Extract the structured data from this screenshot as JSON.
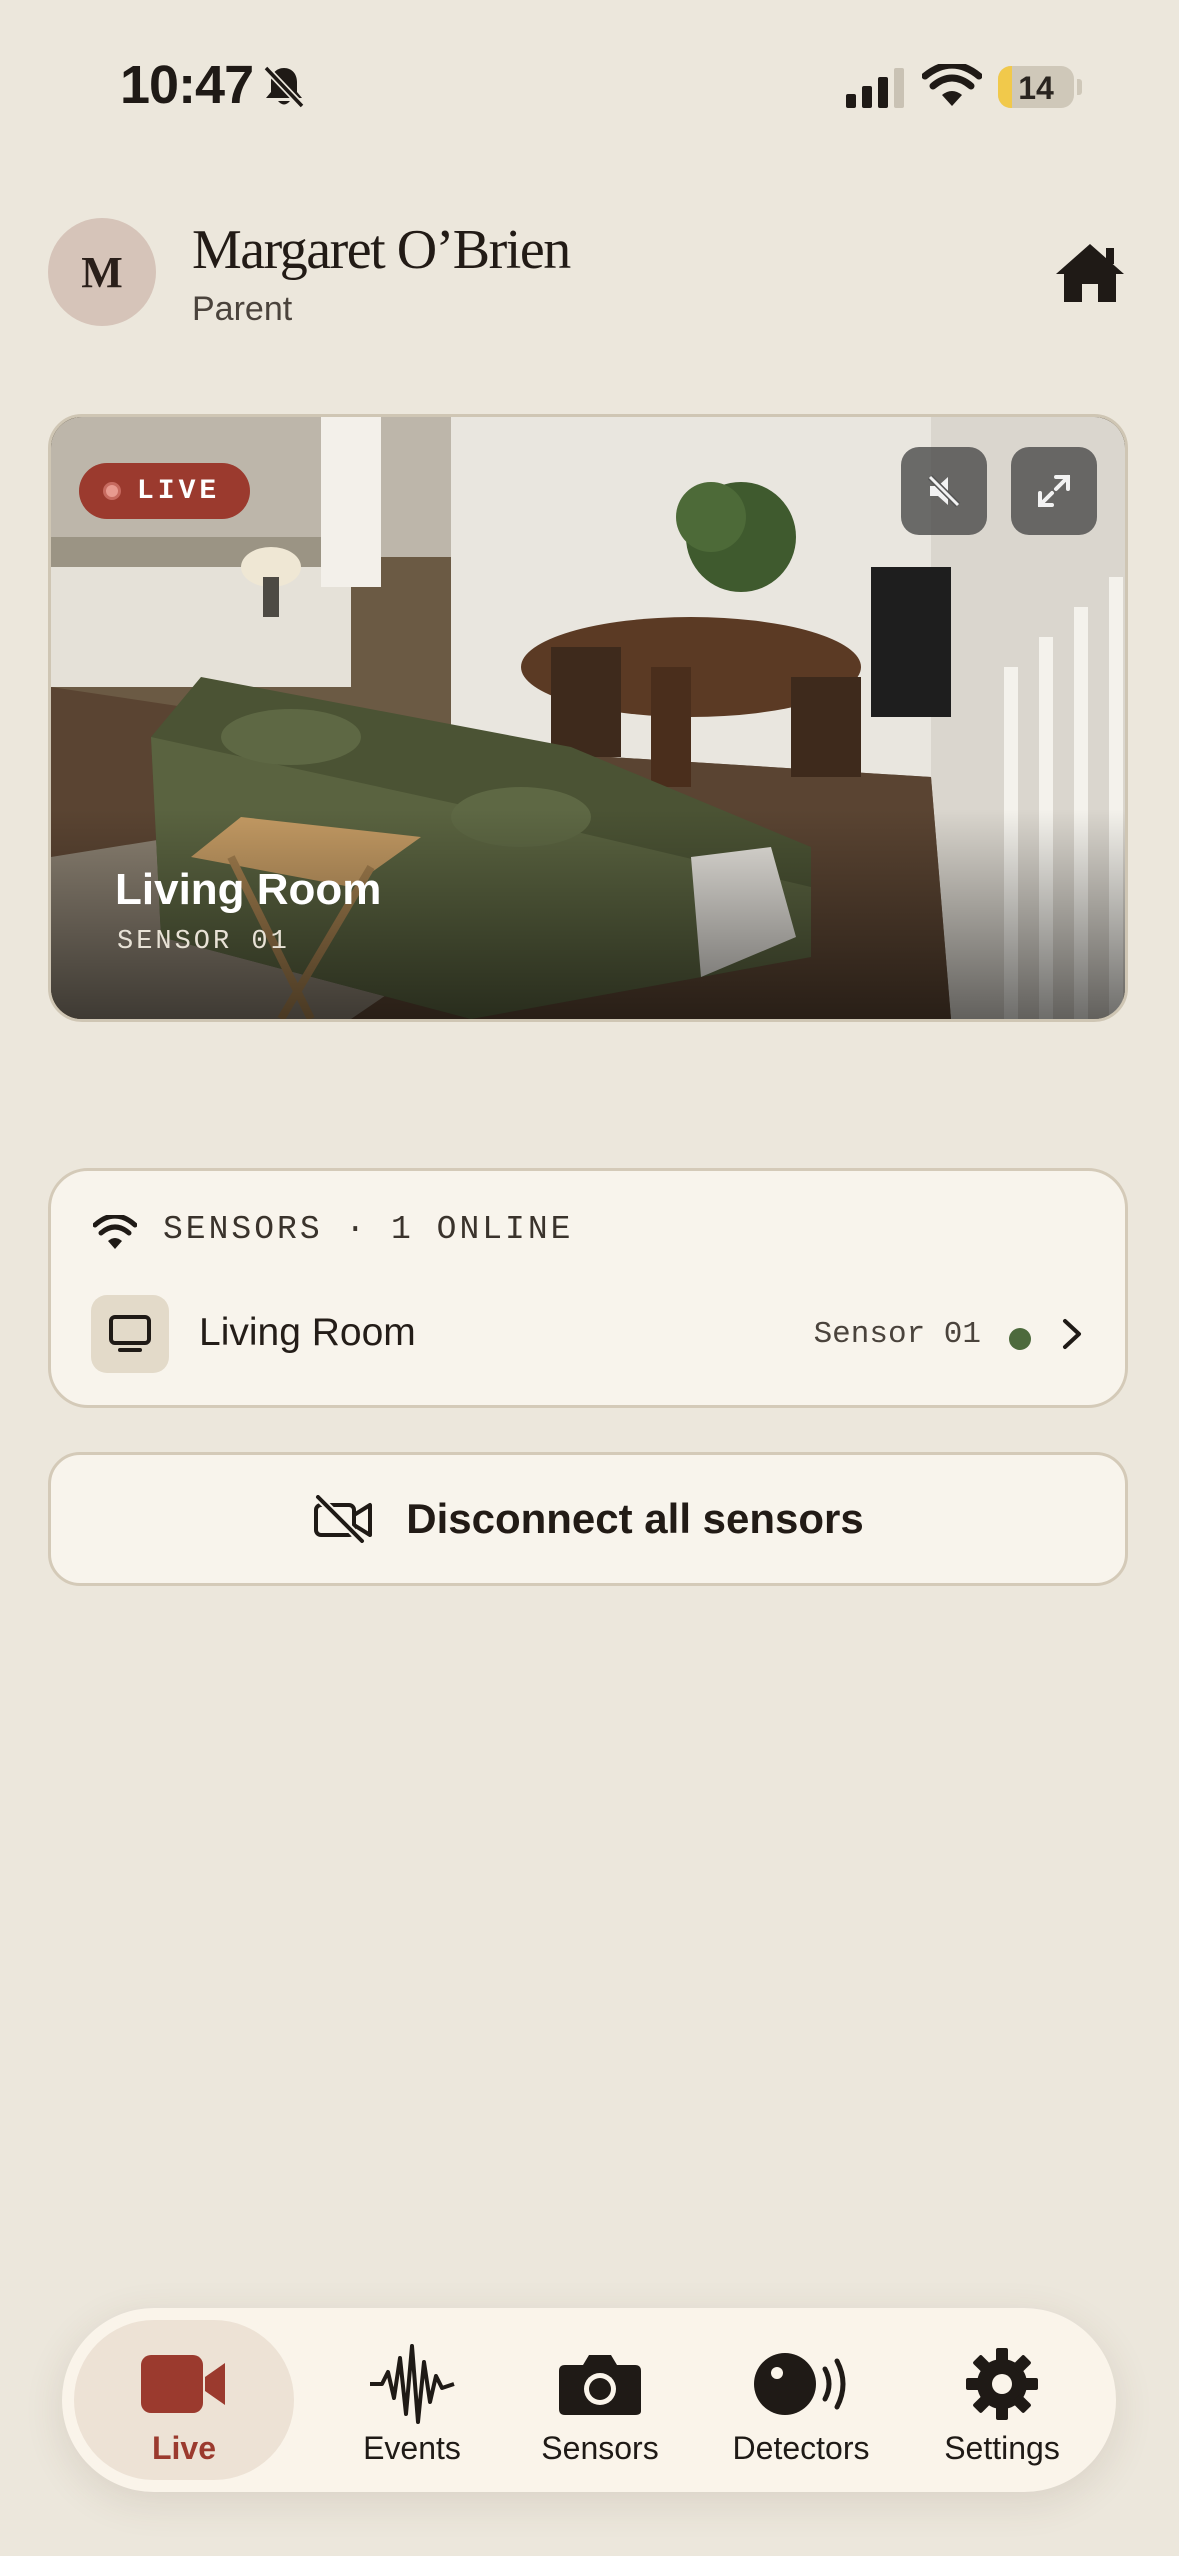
{
  "status_bar": {
    "time": "10:47",
    "battery": "14",
    "icons": [
      "bell-slash-icon",
      "cellular-signal-icon",
      "wifi-icon",
      "battery-icon"
    ]
  },
  "user": {
    "avatar_initial": "M",
    "name": "Margaret O’Brien",
    "role": "Parent"
  },
  "header": {
    "home_icon": "home-icon"
  },
  "camera": {
    "live_label": "LIVE",
    "room": "Living Room",
    "sensor": "SENSOR 01",
    "controls": [
      "mute-icon",
      "fullscreen-icon"
    ]
  },
  "sensors": {
    "header": "SENSORS · 1 ONLINE",
    "items": [
      {
        "name": "Living Room",
        "sensor_id": "Sensor 01",
        "status_color": "#4d6a3c",
        "icon": "monitor-icon"
      }
    ]
  },
  "disconnect": {
    "label": "Disconnect all sensors",
    "icon": "video-off-icon"
  },
  "tabs": [
    {
      "label": "Live",
      "icon": "video-camera-icon",
      "active": true
    },
    {
      "label": "Events",
      "icon": "waveform-icon",
      "active": false
    },
    {
      "label": "Sensors",
      "icon": "camera-icon",
      "active": false
    },
    {
      "label": "Detectors",
      "icon": "detector-icon",
      "active": false
    },
    {
      "label": "Settings",
      "icon": "gear-icon",
      "active": false
    }
  ],
  "colors": {
    "background": "#ece7dc",
    "accent": "#9b3a2e",
    "card": "#f8f4ec",
    "online": "#4d6a3c"
  }
}
